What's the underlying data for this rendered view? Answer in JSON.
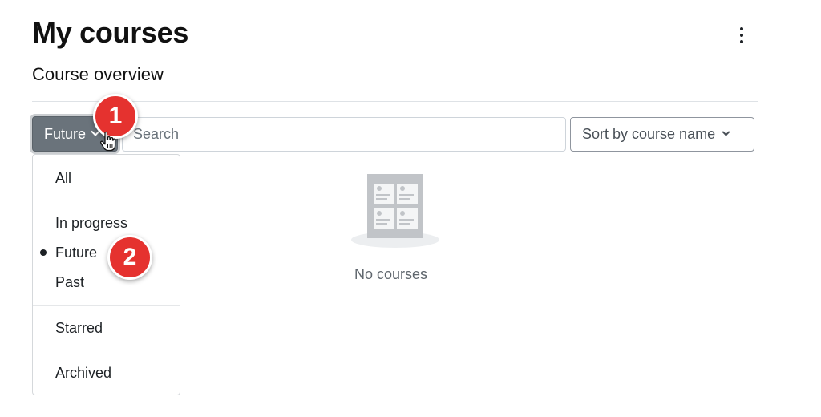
{
  "header": {
    "title": "My courses"
  },
  "course_overview": {
    "title": "Course overview",
    "filter_button_label": "Future",
    "search_placeholder": "Search",
    "sort_button_label": "Sort by course name"
  },
  "dropdown": {
    "items": [
      "All",
      "In progress",
      "Future",
      "Past",
      "Starred",
      "Archived"
    ],
    "selected": "Future"
  },
  "empty_state": {
    "text": "No courses"
  },
  "annotations": {
    "step1": "1",
    "step2": "2"
  },
  "colors": {
    "filter_button_bg": "#6a737b",
    "badge_red": "#e5322f",
    "illustration_gray": "#c1c4c8"
  },
  "icons": [
    "kebab-menu-icon",
    "chevron-down-icon",
    "hand-pointer-cursor-icon",
    "empty-courses-icon"
  ]
}
